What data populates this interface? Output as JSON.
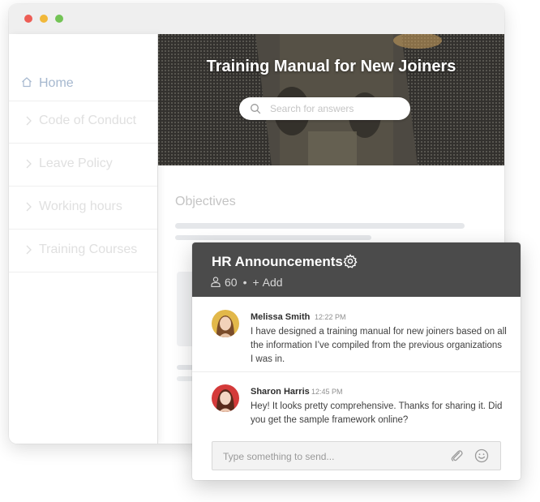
{
  "sidebar": {
    "home_label": "Home",
    "items": [
      {
        "label": "Code of Conduct"
      },
      {
        "label": "Leave Policy"
      },
      {
        "label": "Working hours"
      },
      {
        "label": "Training Courses"
      }
    ]
  },
  "hero": {
    "title": "Training Manual for New Joiners",
    "search_placeholder": "Search for answers"
  },
  "main": {
    "section_title": "Objectives"
  },
  "chat": {
    "title": "HR Announcements",
    "member_count": "60",
    "separator": "•",
    "add_label": "Add",
    "messages": [
      {
        "sender": "Melissa Smith",
        "time": "12:22 PM",
        "text": "I have designed a training manual for new joiners based on all the information I’ve compiled from the previous organizations I was in."
      },
      {
        "sender": "Sharon Harris",
        "time": "12:45 PM",
        "text": "Hey! It looks pretty comprehensive. Thanks for sharing it. Did you get the sample framework online?"
      }
    ],
    "composer_placeholder": "Type something to send..."
  },
  "colors": {
    "chat_header": "#4b4b4b",
    "home_accent": "#a6b8cf",
    "traffic_red": "#ed5d55",
    "traffic_yellow": "#f1b83a",
    "traffic_green": "#73c355"
  },
  "icons": [
    "home-icon",
    "chevron-right-icon",
    "search-icon",
    "gear-icon",
    "person-icon",
    "plus-icon",
    "paperclip-icon",
    "smiley-icon"
  ]
}
